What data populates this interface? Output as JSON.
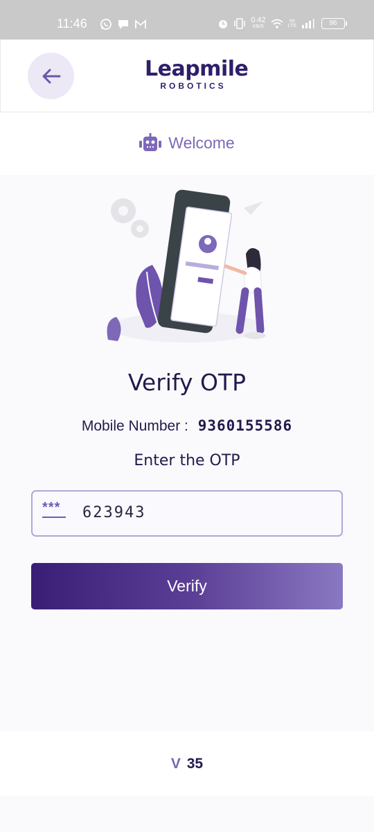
{
  "status_bar": {
    "time": "11:46",
    "net_speed_value": "0.42",
    "net_speed_unit": "KB/S",
    "volte_top": "Vo",
    "volte_bottom": "LTE",
    "battery": "96",
    "left_icons": [
      "whatsapp-icon",
      "chat-icon",
      "gmail-icon"
    ],
    "right_icons": [
      "alarm-icon",
      "vibrate-icon",
      "wifi-icon",
      "signal-icon"
    ]
  },
  "header": {
    "back_icon": "arrow-left-icon",
    "logo_word": "Leapmile",
    "logo_sub": "ROBOTICS"
  },
  "welcome": {
    "icon": "robot-icon",
    "label": "Welcome"
  },
  "main": {
    "illustration": "person-with-phone-illustration",
    "title": "Verify OTP",
    "mobile_label": "Mobile Number :",
    "mobile_value": "9360155586",
    "enter_otp_label": "Enter the OTP",
    "otp_icon": "password-icon",
    "otp_icon_text": "***",
    "otp_value": "623943",
    "verify_label": "Verify"
  },
  "footer": {
    "version_prefix": "V",
    "version_number": "35"
  },
  "colors": {
    "primary_dark": "#3a1e75",
    "primary_light": "#8a78c2",
    "accent": "#7e68b8",
    "text_dark": "#221a4d",
    "status_bar": "#c9c9c9"
  }
}
